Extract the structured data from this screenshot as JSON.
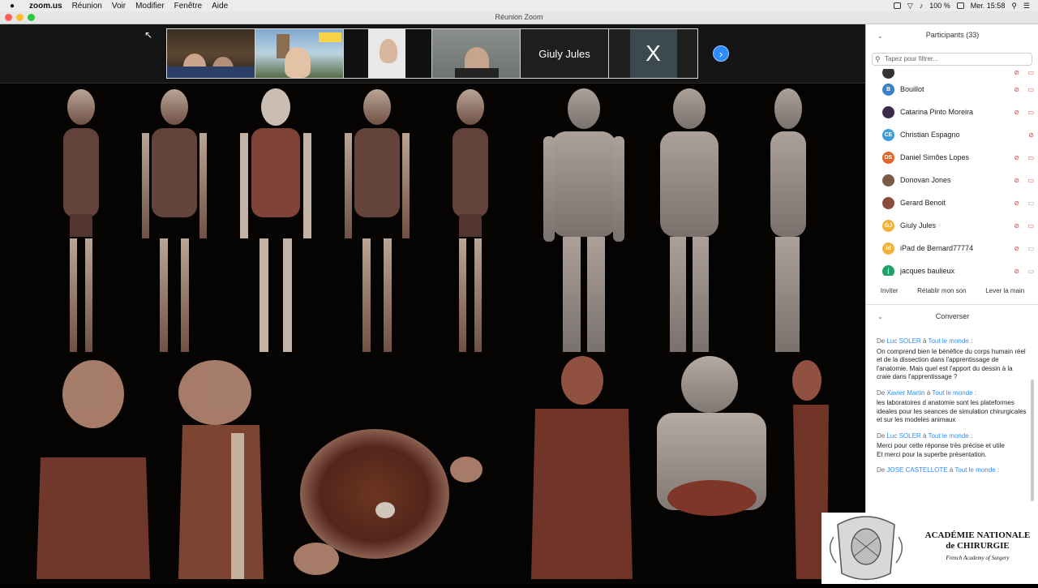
{
  "menubar": {
    "app": "zoom.us",
    "items": [
      "Réunion",
      "Voir",
      "Modifier",
      "Fenêtre",
      "Aide"
    ],
    "battery": "100 %",
    "clock": "Mer. 15:58"
  },
  "window": {
    "title": "Réunion Zoom"
  },
  "gallery": {
    "tiles": [
      {
        "kind": "video"
      },
      {
        "kind": "video"
      },
      {
        "kind": "video"
      },
      {
        "kind": "video"
      },
      {
        "kind": "name",
        "label": "Giuly Jules"
      },
      {
        "kind": "name",
        "label": "X"
      }
    ]
  },
  "participants": {
    "header": "Participants (33)",
    "search_placeholder": "Tapez pour filtrer...",
    "list": [
      {
        "name": "Bouillot",
        "initials": "B",
        "color": "#3b82c4",
        "cam": "off"
      },
      {
        "name": "Catarina Pinto Moreira",
        "initials": "",
        "color": "#3a2b4a",
        "cam": "off"
      },
      {
        "name": "Christian Espagno",
        "initials": "CE",
        "color": "#3f9bd6",
        "cam": "none"
      },
      {
        "name": "Daniel Simões Lopes",
        "initials": "DS",
        "color": "#e0672b",
        "cam": "off"
      },
      {
        "name": "Donovan Jones",
        "initials": "",
        "color": "#7b5a48",
        "cam": "off"
      },
      {
        "name": "Gerard Benoit",
        "initials": "",
        "color": "#8a4a3c",
        "cam": "on"
      },
      {
        "name": "Giuly Jules",
        "initials": "GJ",
        "color": "#f0b23a",
        "cam": "off"
      },
      {
        "name": "iPad de Bernard77774",
        "initials": "id",
        "color": "#f0b23a",
        "cam": "on"
      },
      {
        "name": "jacques baulieux",
        "initials": "j",
        "color": "#22a06b",
        "cam": "on"
      }
    ],
    "buttons": {
      "invite": "Inviter",
      "unmute": "Rétablir mon son",
      "raise": "Lever la main"
    }
  },
  "chat": {
    "header": "Converser",
    "messages": [
      {
        "prefix": "De",
        "from": "Luc SOLER",
        "mid": "à",
        "to": "Tout le monde",
        "suffix": ":",
        "text": "On comprend bien le bénéfice du corps humain réel et de la dissection dans l'apprentissage de l'anatomie. Mais quel est l'apport du dessin à la craie dans l'apprentissage ?"
      },
      {
        "prefix": "De",
        "from": "Xavier Martin",
        "mid": "à",
        "to": "Tout le monde",
        "suffix": ":",
        "text": "les laboratoires d anatomie sont les plateformes ideales pour les seances de simulation chirurgicales et sur les modeles animaux"
      },
      {
        "prefix": "De",
        "from": "Luc SOLER",
        "mid": "à",
        "to": "Tout le monde",
        "suffix": ":",
        "text": "Merci pour cette réponse très précise et utile"
      },
      {
        "prefix": "",
        "from": "",
        "mid": "",
        "to": "",
        "suffix": "",
        "text": "Et merci pour la superbe présentation."
      },
      {
        "prefix": "De",
        "from": "JOSE CASTELLOTE",
        "mid": "à",
        "to": "Tout le monde",
        "suffix": ":",
        "text": ""
      }
    ]
  },
  "logo": {
    "line1": "ACADÉMIE NATIONALE",
    "line2": "de CHIRURGIE",
    "line3": "French Academy of Surgery"
  },
  "icons": [
    "apple-icon",
    "search-icon",
    "chevron-right-icon",
    "mic-muted-icon",
    "camera-off-icon"
  ]
}
